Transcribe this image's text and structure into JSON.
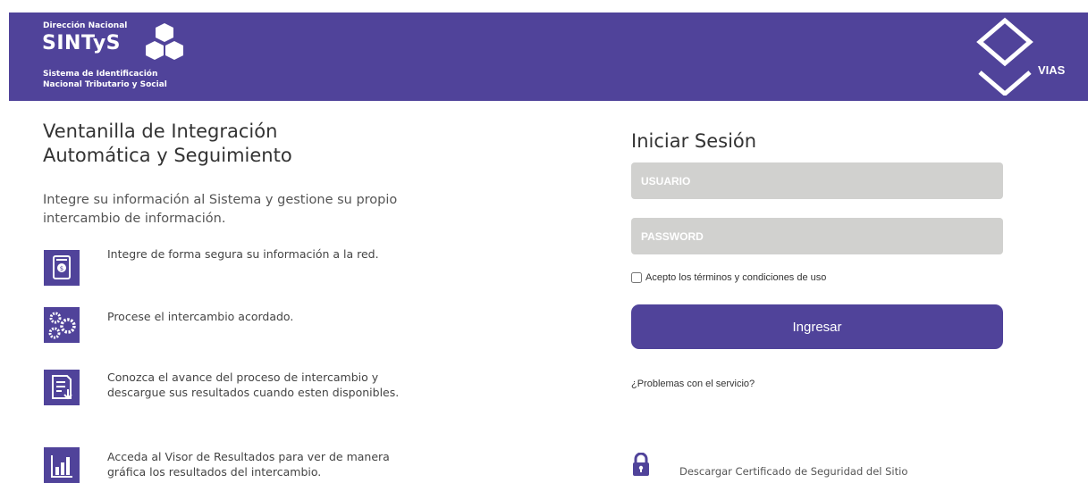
{
  "header": {
    "logo_small": "Dirección Nacional",
    "logo_big": "SINTyS",
    "logo_sub_line1": "Sistema de Identificación",
    "logo_sub_line2": "Nacional Tributario y Social",
    "vias_label": "VIAS",
    "background_color": "#50439a"
  },
  "main": {
    "title_line1": "Ventanilla de Integración",
    "title_line2": "Automática y Seguimiento",
    "description": "Integre su información al Sistema y gestione su propio intercambio de información.",
    "features": [
      {
        "icon": "secure-document-icon",
        "text": "Integre de forma segura su información a la red."
      },
      {
        "icon": "gears-icon",
        "text": "Procese el intercambio acordado."
      },
      {
        "icon": "document-download-icon",
        "text": "Conozca el avance del proceso de intercambio y descargue sus resultados cuando esten disponibles."
      },
      {
        "icon": "bar-chart-icon",
        "text": "Acceda al Visor de Resultados para ver de manera gráfica los resultados del intercambio."
      }
    ]
  },
  "login": {
    "title": "Iniciar Sesión",
    "username_placeholder": "USUARIO",
    "password_placeholder": "PASSWORD",
    "terms_label": "Acepto los términos y condiciones de uso",
    "submit_label": "Ingresar",
    "problems_link": "¿Problemas con el servicio?",
    "certificate_link": "Descargar Certificado de Seguridad del Sitio"
  },
  "colors": {
    "accent": "#50439a",
    "field_bg": "#d1d1cf"
  }
}
